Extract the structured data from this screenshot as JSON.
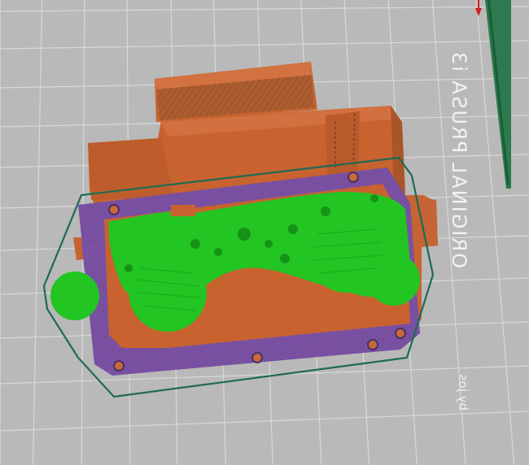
{
  "viewport": {
    "bed_label": "ORIGINAL PRUSA i3",
    "bed_sublabel": "by jos",
    "background": "#b9b9b9",
    "grid_color": "#d8d8d8",
    "colors": {
      "orange_part": "#c8632f",
      "orange_dark": "#a24f22",
      "support_green": "#22c522",
      "support_green_dark": "#138a13",
      "brim_purple": "#7d55a6",
      "outline_teal": "#1e6a55",
      "axis_red": "#d41e1e",
      "axis_green": "#1a7a46"
    }
  }
}
